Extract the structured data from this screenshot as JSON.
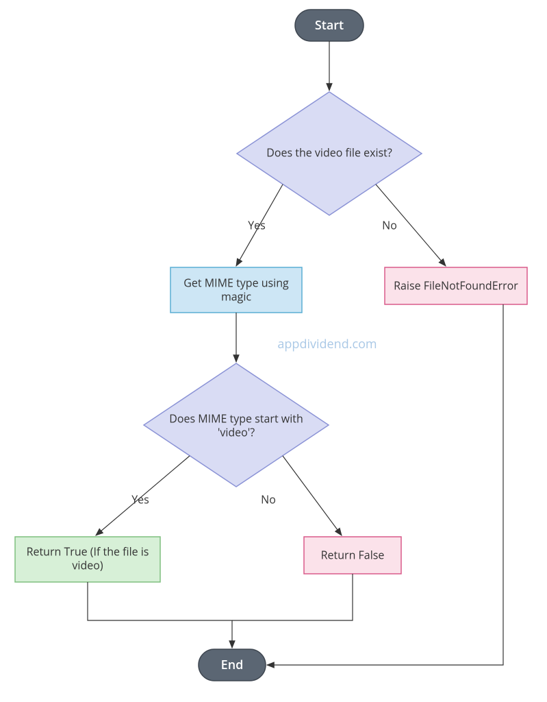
{
  "terminators": {
    "start": "Start",
    "end": "End"
  },
  "decisions": {
    "file_exists": "Does the video file exist?",
    "mime_video_l1": "Does MIME type start with",
    "mime_video_l2": "'video'?"
  },
  "processes": {
    "get_mime_l1": "Get MIME type using",
    "get_mime_l2": "magic",
    "raise_error": "Raise FileNotFoundError",
    "return_true_l1": "Return True (If the file is",
    "return_true_l2": "video)",
    "return_false": "Return False"
  },
  "edge_labels": {
    "yes1": "Yes",
    "no1": "No",
    "yes2": "Yes",
    "no2": "No"
  },
  "watermark": "appdividend.com",
  "colors": {
    "terminator_fill": "#5b6673",
    "terminator_stroke": "#3e4650",
    "decision_fill": "#d9dcf4",
    "decision_stroke": "#8b93d6",
    "blue_fill": "#cde6f5",
    "blue_stroke": "#5aaed3",
    "pink_fill": "#fbe2ea",
    "pink_stroke": "#d95a8a",
    "green_fill": "#d7f0d7",
    "green_stroke": "#7fbf7f",
    "arrow": "#333333"
  }
}
